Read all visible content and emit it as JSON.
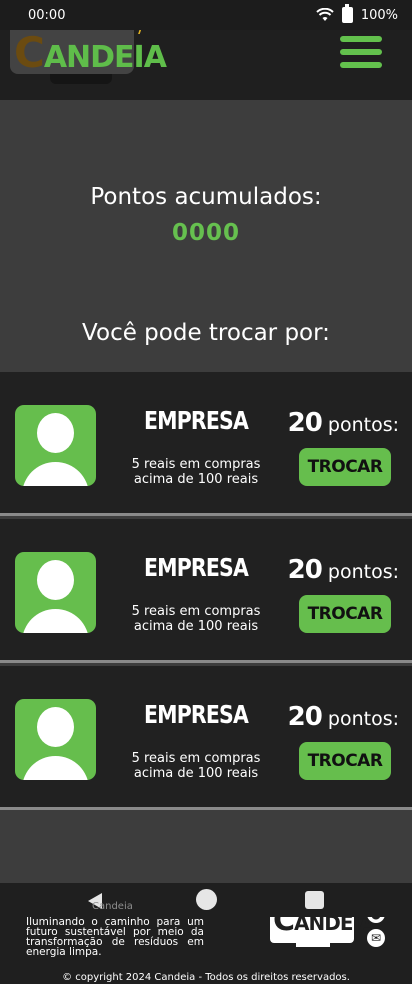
{
  "status": {
    "time": "00:00",
    "battery": "100%"
  },
  "header": {
    "logo_text": "CANDEIA",
    "logo_first_letter": "C",
    "logo_rest": "ANDEIA"
  },
  "points": {
    "label": "Pontos acumulados:",
    "value": "0000"
  },
  "trade_title": "Você pode trocar por:",
  "offers": [
    {
      "company": "EMPRESA",
      "description": "5 reais em compras acima de 100 reais",
      "points": "20",
      "points_unit": "pontos:",
      "button": "TROCAR"
    },
    {
      "company": "EMPRESA",
      "description": "5 reais em compras acima de 100 reais",
      "points": "20",
      "points_unit": "pontos:",
      "button": "TROCAR"
    },
    {
      "company": "EMPRESA",
      "description": "5 reais em compras acima de 100 reais",
      "points": "20",
      "points_unit": "pontos:",
      "button": "TROCAR"
    }
  ],
  "nav": {
    "brand": "Candeia"
  },
  "footer": {
    "text": "Iluminando o caminho para um futuro sustentável por meio da transformação de resíduos em energia limpa.",
    "copyright": "© copyright 2024 Candeia - Todos os direitos reservados."
  },
  "icons": [
    "wifi-icon",
    "battery-icon",
    "menu-icon",
    "user-icon",
    "github-icon",
    "mail-icon",
    "back-icon",
    "home-icon",
    "recent-apps-icon"
  ],
  "colors": {
    "accent": "#66be4d",
    "header_bg": "#1f1f1f",
    "page_bg": "#3d3d3d",
    "logo_bolt": "#e2b322"
  }
}
